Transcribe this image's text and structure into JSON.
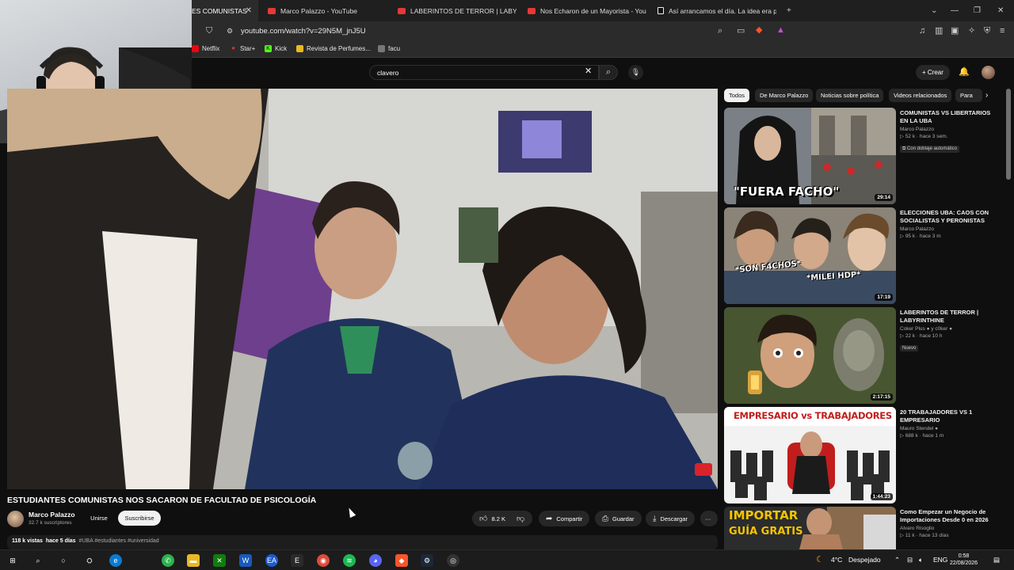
{
  "browser": {
    "tabs": [
      {
        "label": "ES COMUNISTAS",
        "active": true
      },
      {
        "label": "Marco Palazzo - YouTube"
      },
      {
        "label": "LABERINTOS DE TERROR | LABYRINTH"
      },
      {
        "label": "Nos Echaron de un Mayorista - YouTu"
      },
      {
        "label": "Así arrancamos el día. La idea era pr"
      }
    ],
    "url": "youtube.com/watch?v=29N5M_jnJ5U",
    "bookmarks": [
      "Netflix",
      "Star+",
      "Kick",
      "Revista de Perfumes...",
      "facu"
    ]
  },
  "youtube": {
    "search_value": "clavero",
    "create_label": "Crear",
    "video": {
      "title": "ESTUDIANTES COMUNISTAS NOS SACARON DE FACULTAD DE PSICOLOGÍA",
      "channel": "Marco Palazzo",
      "subscribers": "32.7 k suscriptores",
      "join_label": "Unirse",
      "subscribe_label": "Suscribirse",
      "likes": "8.2 K",
      "share_label": "Compartir",
      "save_label": "Guardar",
      "download_label": "Descargar",
      "views": "118 k vistas",
      "date": "hace 5 días",
      "tags": "#UBA #estudiantes #universidad"
    },
    "chips": [
      "Todos",
      "De Marco Palazzo",
      "Noticias sobre política",
      "Videos relacionados",
      "Para"
    ],
    "recommendations": [
      {
        "title": "COMUNISTAS VS LIBERTARIOS EN LA UBA",
        "channel": "Marco Palazzo",
        "views": "52 k",
        "age": "hace 3 sem.",
        "badge": "Con doblaje automático",
        "duration": "29:14",
        "thumb_text": "\"FUERA FACHO\""
      },
      {
        "title": "ELECCIONES UBA: CAOS CON SOCIALISTAS Y PERONISTAS",
        "channel": "Marco Palazzo",
        "views": "95 k",
        "age": "hace 3 m",
        "badge": "",
        "duration": "17:19",
        "thumb_text_1": "*SON F4CHOS*",
        "thumb_text_2": "*MILEI HDP*"
      },
      {
        "title": "LABERINTOS DE TERROR | LABYRINTHINE",
        "channel": "Coker Plus",
        "channel_extra": "y c0ker",
        "views": "22 k",
        "age": "hace 10 h",
        "badge": "Nuevo",
        "duration": "2:17:15"
      },
      {
        "title": "20 TRABAJADORES VS 1 EMPRESARIO",
        "channel": "Mauro Stendel",
        "views": "688 k",
        "age": "hace 1 m",
        "badge": "",
        "duration": "1:44:23",
        "thumb_text": "EMPRESARIO vs TRABAJADORES"
      },
      {
        "title": "Como Empezar un Negocio de Importaciones Desde 0 en 2026",
        "channel": "Alvaro Risoglio",
        "views": "11 k",
        "age": "hace 13 días",
        "badge": "",
        "duration": "",
        "thumb_text_1": "IMPORTAR",
        "thumb_text_2": "GUÍA GRATIS"
      }
    ]
  },
  "taskbar": {
    "weather": "4°C",
    "weather_desc": "Despejado",
    "lang": "ENG",
    "time": "0:58",
    "date": "22/08/2026"
  },
  "colors": {
    "accent_red": "#ff0033",
    "bg": "#0f0f0f"
  }
}
